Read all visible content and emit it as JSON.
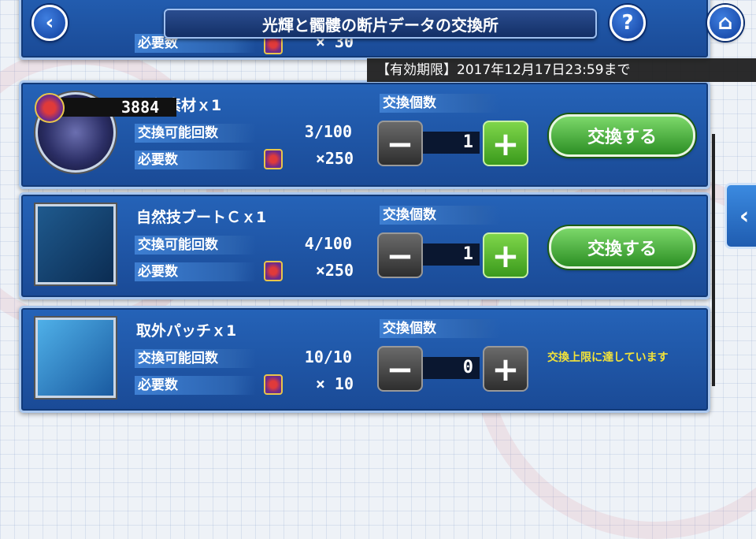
{
  "header": {
    "title": "光輝と髑髏の断片データの交換所",
    "back_glyph": "‹",
    "help_glyph": "?",
    "home_glyph": "⌂"
  },
  "expiry": "【有効期限】2017年12月17日23:59まで",
  "points": "3884",
  "top_partial": {
    "label": "必要数",
    "value": "× 30"
  },
  "labels": {
    "count": "交換可能回数",
    "cost": "必要数",
    "qty_header": "交換個数",
    "exchange": "交換する",
    "limit_reached": "交換上限に達しています"
  },
  "items": [
    {
      "name": "進化素材ｘ1",
      "count": "3/100",
      "cost": "×250",
      "qty": "1",
      "thumb_icon": "robot-head-icon"
    },
    {
      "name": "自然技ブートＣｘ1",
      "count": "4/100",
      "cost": "×250",
      "qty": "1",
      "thumb_icon": "sprout-chip-icon"
    },
    {
      "name": "取外パッチｘ1",
      "count": "10/10",
      "cost": "× 10",
      "qty": "0",
      "thumb_icon": "patch-icon"
    }
  ],
  "side_tab_glyph": "‹",
  "stepper": {
    "minus": "−",
    "plus": "+"
  }
}
